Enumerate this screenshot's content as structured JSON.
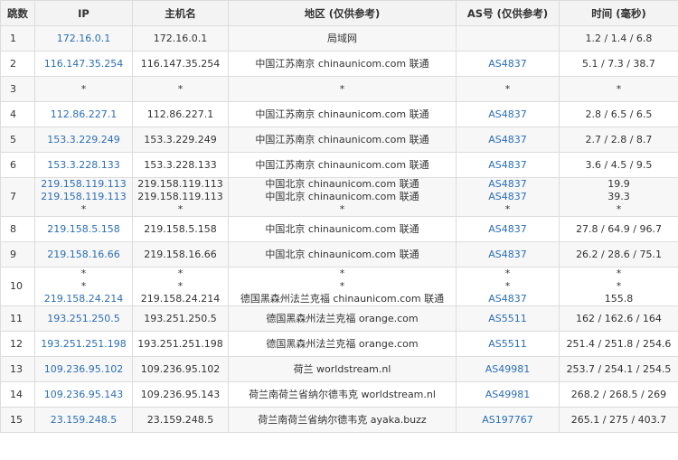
{
  "headers": {
    "hop": "跳数",
    "ip": "IP",
    "host": "主机名",
    "location": "地区 (仅供参考)",
    "asn": "AS号 (仅供参考)",
    "time": "时间 (毫秒)"
  },
  "rows": [
    {
      "hop": "1",
      "ip": [
        "172.16.0.1"
      ],
      "host": [
        "172.16.0.1"
      ],
      "location": [
        "局域网"
      ],
      "asn": [
        ""
      ],
      "time": [
        "1.2 / 1.4 / 6.8"
      ]
    },
    {
      "hop": "2",
      "ip": [
        "116.147.35.254"
      ],
      "host": [
        "116.147.35.254"
      ],
      "location": [
        "中国江苏南京 chinaunicom.com 联通"
      ],
      "asn": [
        "AS4837"
      ],
      "time": [
        "5.1 / 7.3 / 38.7"
      ]
    },
    {
      "hop": "3",
      "ip": [
        "*"
      ],
      "host": [
        "*"
      ],
      "location": [
        "*"
      ],
      "asn": [
        "*"
      ],
      "time": [
        "*"
      ]
    },
    {
      "hop": "4",
      "ip": [
        "112.86.227.1"
      ],
      "host": [
        "112.86.227.1"
      ],
      "location": [
        "中国江苏南京 chinaunicom.com 联通"
      ],
      "asn": [
        "AS4837"
      ],
      "time": [
        "2.8 / 6.5 / 6.5"
      ]
    },
    {
      "hop": "5",
      "ip": [
        "153.3.229.249"
      ],
      "host": [
        "153.3.229.249"
      ],
      "location": [
        "中国江苏南京 chinaunicom.com 联通"
      ],
      "asn": [
        "AS4837"
      ],
      "time": [
        "2.7 / 2.8 / 8.7"
      ]
    },
    {
      "hop": "6",
      "ip": [
        "153.3.228.133"
      ],
      "host": [
        "153.3.228.133"
      ],
      "location": [
        "中国江苏南京 chinaunicom.com 联通"
      ],
      "asn": [
        "AS4837"
      ],
      "time": [
        "3.6 / 4.5 / 9.5"
      ]
    },
    {
      "hop": "7",
      "ip": [
        "219.158.119.113",
        "219.158.119.113",
        "*"
      ],
      "host": [
        "219.158.119.113",
        "219.158.119.113",
        "*"
      ],
      "location": [
        "中国北京 chinaunicom.com 联通",
        "中国北京 chinaunicom.com 联通",
        "*"
      ],
      "asn": [
        "AS4837",
        "AS4837",
        "*"
      ],
      "time": [
        "19.9",
        "39.3",
        "*"
      ]
    },
    {
      "hop": "8",
      "ip": [
        "219.158.5.158"
      ],
      "host": [
        "219.158.5.158"
      ],
      "location": [
        "中国北京 chinaunicom.com 联通"
      ],
      "asn": [
        "AS4837"
      ],
      "time": [
        "27.8 / 64.9 / 96.7"
      ]
    },
    {
      "hop": "9",
      "ip": [
        "219.158.16.66"
      ],
      "host": [
        "219.158.16.66"
      ],
      "location": [
        "中国北京 chinaunicom.com 联通"
      ],
      "asn": [
        "AS4837"
      ],
      "time": [
        "26.2 / 28.6 / 75.1"
      ]
    },
    {
      "hop": "10",
      "ip": [
        "*",
        "*",
        "219.158.24.214"
      ],
      "host": [
        "*",
        "*",
        "219.158.24.214"
      ],
      "location": [
        "*",
        "*",
        "德国黑森州法兰克福 chinaunicom.com 联通"
      ],
      "asn": [
        "*",
        "*",
        "AS4837"
      ],
      "time": [
        "*",
        "*",
        "155.8"
      ]
    },
    {
      "hop": "11",
      "ip": [
        "193.251.250.5"
      ],
      "host": [
        "193.251.250.5"
      ],
      "location": [
        "德国黑森州法兰克福 orange.com"
      ],
      "asn": [
        "AS5511"
      ],
      "time": [
        "162 / 162.6 / 164"
      ]
    },
    {
      "hop": "12",
      "ip": [
        "193.251.251.198"
      ],
      "host": [
        "193.251.251.198"
      ],
      "location": [
        "德国黑森州法兰克福 orange.com"
      ],
      "asn": [
        "AS5511"
      ],
      "time": [
        "251.4 / 251.8 / 254.6"
      ]
    },
    {
      "hop": "13",
      "ip": [
        "109.236.95.102"
      ],
      "host": [
        "109.236.95.102"
      ],
      "location": [
        "荷兰 worldstream.nl"
      ],
      "asn": [
        "AS49981"
      ],
      "time": [
        "253.7 / 254.1 / 254.5"
      ]
    },
    {
      "hop": "14",
      "ip": [
        "109.236.95.143"
      ],
      "host": [
        "109.236.95.143"
      ],
      "location": [
        "荷兰南荷兰省纳尔德韦克 worldstream.nl"
      ],
      "asn": [
        "AS49981"
      ],
      "time": [
        "268.2 / 268.5 / 269"
      ]
    },
    {
      "hop": "15",
      "ip": [
        "23.159.248.5"
      ],
      "host": [
        "23.159.248.5"
      ],
      "location": [
        "荷兰南荷兰省纳尔德韦克 ayaka.buzz"
      ],
      "asn": [
        "AS197767"
      ],
      "time": [
        "265.1 / 275 / 403.7"
      ]
    }
  ],
  "colors": {
    "link": "#2a6ebb",
    "header_bg": "#f3f3f3",
    "stripe_bg": "#f7f7f7",
    "border": "#dcdcdc"
  }
}
